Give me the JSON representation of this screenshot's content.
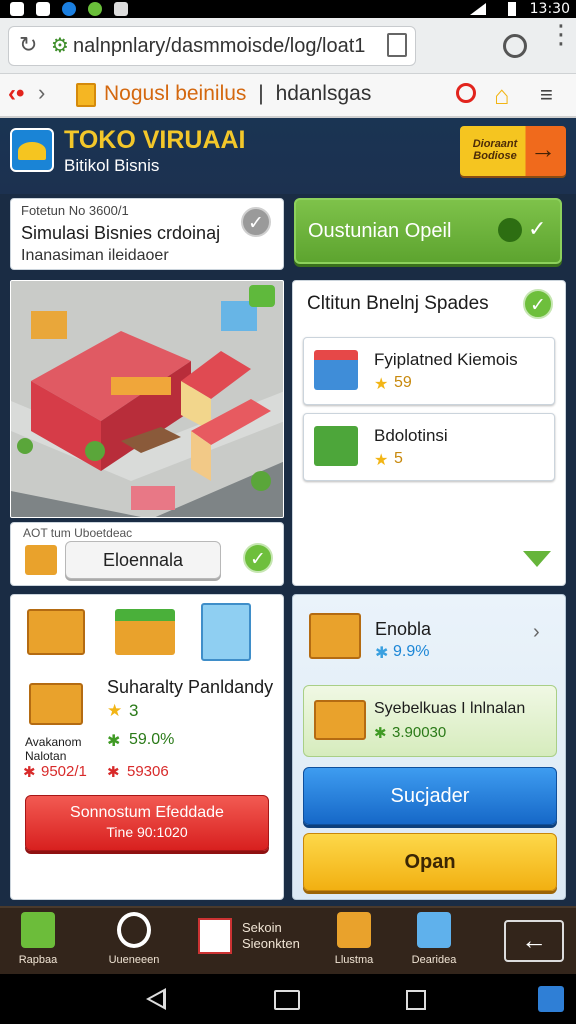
{
  "status": {
    "time": "13:30"
  },
  "browser": {
    "url": "nalnpnlary/dasmmoisde/log/loat1"
  },
  "nav": {
    "title": "Nogusl beinilus",
    "title_sep": "|",
    "title_rest": "hdanlsgas"
  },
  "header": {
    "title": "TOKO VIRUAAI",
    "subtitle": "Bitikol Bisnis",
    "cta": "Dioraant Bodiose"
  },
  "left_card": {
    "caption": "Fotetun No 3600/1",
    "heading": "Simulasi Bisnies crdoinaj",
    "note": "Inanasiman ileidaoer"
  },
  "green_button": {
    "label": "Oustunian Opeil"
  },
  "spades": {
    "title": "Cltitun Bnelnj Spades",
    "items": [
      {
        "name": "Fyiplatned Kiemois",
        "value": "59"
      },
      {
        "name": "Bdolotinsi",
        "value": "5"
      }
    ]
  },
  "shop": {
    "caption": "AOT tum Uboetdeac",
    "button": "Eloennala"
  },
  "lower_left": {
    "title": "Suharalty Panldandy",
    "star_value": "3",
    "pct": "59.0%",
    "cost": "59306",
    "small_label_1": "Avakanom",
    "small_label_2": "Nalotan",
    "small_cost": "9502/1",
    "red_button_line1": "Sonnostum Efeddade",
    "red_button_line2": "Tine 90:1020"
  },
  "lower_right": {
    "item_name": "Enobla",
    "item_pct": "9.9%",
    "item2_name": "Syebelkuas I lnlnalan",
    "item2_value": "3.90030",
    "blue_button": "Sucjader",
    "yellow_button": "Opan"
  },
  "bottom_nav": [
    {
      "label": "Rapbaa"
    },
    {
      "label": "Uueneeen"
    },
    {
      "label": "Sekoin Sieonkten"
    },
    {
      "label": "Llustma"
    },
    {
      "label": "Dearidea"
    }
  ],
  "colors": {
    "accent": "#f3c72a",
    "green": "#6ebf3c",
    "blue": "#1e7ee0",
    "red": "#e83a35",
    "yellow": "#f9c71f"
  }
}
